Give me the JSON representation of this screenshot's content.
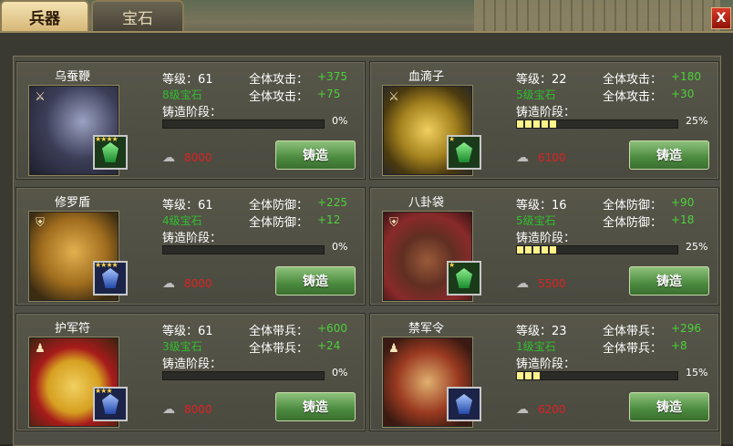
{
  "tabs": [
    {
      "label": "兵器",
      "active": true
    },
    {
      "label": "宝石",
      "active": false
    }
  ],
  "close_label": "X",
  "colors": {
    "stat_value": "#4bd23a",
    "cost_red": "#e02020",
    "button_green": "#4b8a3f"
  },
  "items": [
    {
      "name": "乌蚕鞭",
      "type_icon": "weapon-icon",
      "gem_color": "green",
      "gem_stars": "★★★★",
      "level_label": "等级：61",
      "stat_label": "全体攻击：",
      "stat_value": "+375",
      "gem_label": "8级宝石",
      "gem_stat_label": "全体攻击：",
      "gem_stat_value": "+75",
      "forge_stage_label": "铸造阶段：",
      "progress_percent": "0%",
      "progress": 0,
      "cost": "8000",
      "button": "铸造"
    },
    {
      "name": "血滴子",
      "type_icon": "weapon-icon",
      "gem_color": "green",
      "gem_stars": "★",
      "level_label": "等级：22",
      "stat_label": "全体攻击：",
      "stat_value": "+180",
      "gem_label": "5级宝石",
      "gem_stat_label": "全体攻击：",
      "gem_stat_value": "+30",
      "forge_stage_label": "铸造阶段：",
      "progress_percent": "25%",
      "progress": 0.25,
      "cost": "6100",
      "button": "铸造"
    },
    {
      "name": "修罗盾",
      "type_icon": "shield-icon",
      "gem_color": "blue",
      "gem_stars": "★★★★",
      "level_label": "等级：61",
      "stat_label": "全体防御：",
      "stat_value": "+225",
      "gem_label": "4级宝石",
      "gem_stat_label": "全体防御：",
      "gem_stat_value": "+12",
      "forge_stage_label": "铸造阶段：",
      "progress_percent": "0%",
      "progress": 0,
      "cost": "8000",
      "button": "铸造"
    },
    {
      "name": "八卦袋",
      "type_icon": "shield-icon",
      "gem_color": "green",
      "gem_stars": "★",
      "level_label": "等级：16",
      "stat_label": "全体防御：",
      "stat_value": "+90",
      "gem_label": "5级宝石",
      "gem_stat_label": "全体防御：",
      "gem_stat_value": "+18",
      "forge_stage_label": "铸造阶段：",
      "progress_percent": "25%",
      "progress": 0.25,
      "cost": "5500",
      "button": "铸造"
    },
    {
      "name": "护军符",
      "type_icon": "soldier-icon",
      "gem_color": "blue",
      "gem_stars": "★★★",
      "level_label": "等级：61",
      "stat_label": "全体带兵：",
      "stat_value": "+600",
      "gem_label": "3级宝石",
      "gem_stat_label": "全体带兵：",
      "gem_stat_value": "+24",
      "forge_stage_label": "铸造阶段：",
      "progress_percent": "0%",
      "progress": 0,
      "cost": "8000",
      "button": "铸造"
    },
    {
      "name": "禁军令",
      "type_icon": "soldier-icon",
      "gem_color": "blue",
      "gem_stars": "",
      "level_label": "等级：23",
      "stat_label": "全体带兵：",
      "stat_value": "+296",
      "gem_label": "1级宝石",
      "gem_stat_label": "全体带兵：",
      "gem_stat_value": "+8",
      "forge_stage_label": "铸造阶段：",
      "progress_percent": "15%",
      "progress": 0.15,
      "cost": "6200",
      "button": "铸造"
    }
  ]
}
